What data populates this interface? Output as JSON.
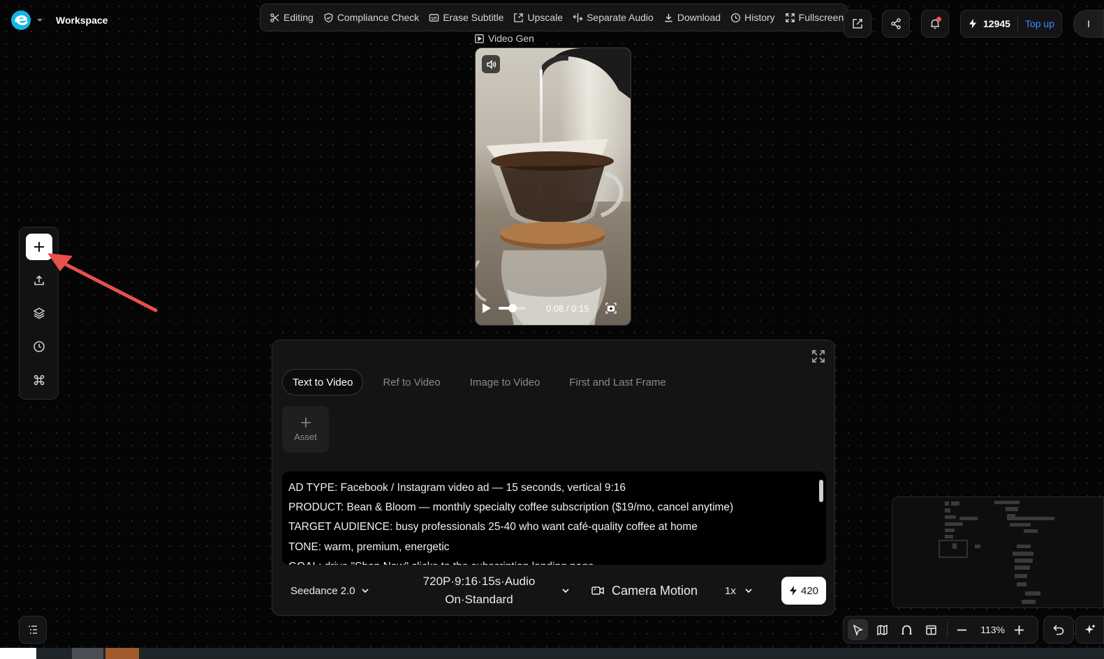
{
  "workspace": {
    "title": "Workspace"
  },
  "toolbar": {
    "items": [
      {
        "label": "Editing",
        "icon": "scissors-icon"
      },
      {
        "label": "Compliance Check",
        "icon": "shield-check-icon"
      },
      {
        "label": "Erase Subtitle",
        "icon": "subtitle-icon"
      },
      {
        "label": "Upscale",
        "icon": "upscale-icon"
      },
      {
        "label": "Separate Audio",
        "icon": "separate-audio-icon"
      },
      {
        "label": "Download",
        "icon": "download-icon"
      },
      {
        "label": "History",
        "icon": "clock-icon"
      },
      {
        "label": "Fullscreen",
        "icon": "fullscreen-icon"
      }
    ]
  },
  "header": {
    "credits": "12945",
    "topup_label": "Top up",
    "avatar_initial": "I"
  },
  "node": {
    "label": "Video Gen",
    "video": {
      "timecode": "0:08 / 0:15",
      "progress_fraction": 0.53
    }
  },
  "panel": {
    "tabs": [
      {
        "label": "Text to Video",
        "active": true
      },
      {
        "label": "Ref to Video",
        "active": false
      },
      {
        "label": "Image to Video",
        "active": false
      },
      {
        "label": "First and Last Frame",
        "active": false
      }
    ],
    "asset_label": "Asset",
    "prompt_lines": [
      "AD TYPE: Facebook / Instagram video ad — 15 seconds, vertical 9:16",
      "PRODUCT: Bean & Bloom — monthly specialty coffee subscription ($19/mo, cancel anytime)",
      "TARGET AUDIENCE: busy professionals 25-40 who want café-quality coffee at home",
      "TONE: warm, premium, energetic",
      "GOAL: drive \"Shop Now\" clicks to the subscription landing page"
    ],
    "model": "Seedance 2.0",
    "spec_line1": "720P·9:16·15s·Audio",
    "spec_line2": "On·Standard",
    "camera_label": "Camera Motion",
    "speed": "1x",
    "cost": "420"
  },
  "canvas": {
    "zoom": "113%"
  },
  "colors": {
    "accent": "#3d8bff",
    "notification": "#ff4d4d",
    "arrow": "#e8504a",
    "logo": "#12b6e8"
  }
}
